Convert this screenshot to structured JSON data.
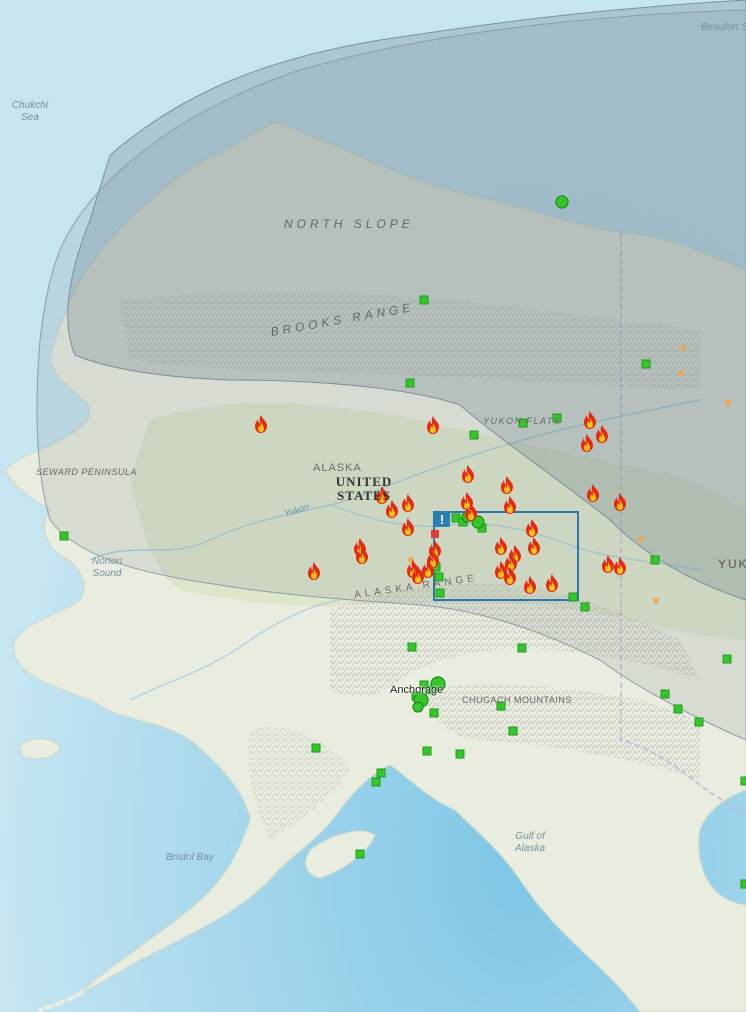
{
  "map": {
    "labels": {
      "beaufort_sea": "Beaufort Sea",
      "chukchi_sea": "Chukchi Sea",
      "north_slope": "NORTH SLOPE",
      "brooks_range": "BROOKS RANGE",
      "yukon_flats": "YUKON FLATS",
      "seward_peninsula": "SEWARD PENINSULA",
      "alaska": "ALASKA",
      "united_states": "UNITED STATES",
      "yukon_river": "Yukon",
      "norton_sound": "Norton Sound",
      "alaska_range": "ALASKA RANGE",
      "anchorage": "Anchorage",
      "chugach_mountains": "CHUGACH MOUNTAINS",
      "gulf_of_alaska": "Gulf of Alaska",
      "bristol_bay": "Bristol Bay",
      "yukon_territory_partial": "YUK"
    },
    "alert_badge": "!",
    "marker_legend": {
      "fire_icon": "active wildfire",
      "green_square": "monitoring station",
      "green_circle": "large monitoring site",
      "orange_dot": "small hotspot"
    },
    "colors": {
      "ocean": "#bfe1ef",
      "land": "#e9eddf",
      "forest": "#d6e2c3",
      "smoke_overlay": "#7d8f98",
      "station_green": "#35c62b",
      "fire_red": "#e52a12",
      "fire_yellow": "#f7c21a",
      "alert_blue": "#2a7fb5",
      "highlight_box": "#2a78ad"
    }
  }
}
